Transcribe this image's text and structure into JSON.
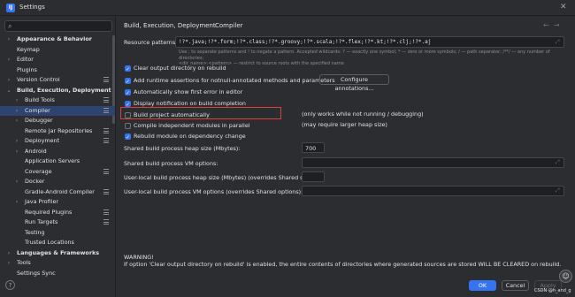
{
  "window": {
    "title": "Settings",
    "app_icon": "IJ"
  },
  "sidebar": {
    "items": [
      {
        "label": "Appearance & Behavior",
        "chev": "›",
        "indent": 0,
        "bold": true
      },
      {
        "label": "Keymap",
        "chev": "",
        "indent": 0
      },
      {
        "label": "Editor",
        "chev": "›",
        "indent": 0
      },
      {
        "label": "Plugins",
        "chev": "",
        "indent": 0
      },
      {
        "label": "Version Control",
        "chev": "›",
        "indent": 0,
        "sq": true
      },
      {
        "label": "Build, Execution, Deployment",
        "chev": "⌄",
        "indent": 0,
        "bold": true
      },
      {
        "label": "Build Tools",
        "chev": "›",
        "indent": 1,
        "sq": true
      },
      {
        "label": "Compiler",
        "chev": "›",
        "indent": 1,
        "sq": true,
        "selected": true
      },
      {
        "label": "Debugger",
        "chev": "›",
        "indent": 1
      },
      {
        "label": "Remote Jar Repositories",
        "chev": "",
        "indent": 1,
        "sq": true
      },
      {
        "label": "Deployment",
        "chev": "›",
        "indent": 1,
        "sq": true
      },
      {
        "label": "Android",
        "chev": "›",
        "indent": 1
      },
      {
        "label": "Application Servers",
        "chev": "",
        "indent": 1
      },
      {
        "label": "Coverage",
        "chev": "",
        "indent": 1,
        "sq": true
      },
      {
        "label": "Docker",
        "chev": "›",
        "indent": 1
      },
      {
        "label": "Gradle-Android Compiler",
        "chev": "",
        "indent": 1,
        "sq": true
      },
      {
        "label": "Java Profiler",
        "chev": "›",
        "indent": 1
      },
      {
        "label": "Required Plugins",
        "chev": "",
        "indent": 1,
        "sq": true
      },
      {
        "label": "Run Targets",
        "chev": "",
        "indent": 1,
        "sq": true
      },
      {
        "label": "Testing",
        "chev": "",
        "indent": 1
      },
      {
        "label": "Trusted Locations",
        "chev": "",
        "indent": 1
      },
      {
        "label": "Languages & Frameworks",
        "chev": "›",
        "indent": 0,
        "bold": true
      },
      {
        "label": "Tools",
        "chev": "›",
        "indent": 0
      },
      {
        "label": "Settings Sync",
        "chev": "",
        "indent": 0
      }
    ]
  },
  "breadcrumb": {
    "parent": "Build, Execution, Deployment",
    "separator": "›",
    "current": "Compiler"
  },
  "resource_patterns": {
    "label": "Resource patterns:",
    "value": "!?*.java;!?*.form;!?*.class;!?*.groovy;!?*.scala;!?*.flex;!?*.kt;!?*.clj;!?*.aj",
    "hint_line1": "Use ; to separate patterns and ! to negate a pattern. Accepted wildcards: ? — exactly one symbol; * — zero or more symbols; / — path separator; /**/ — any number of directories;",
    "hint_line2": "<dir_name>:<pattern> — restrict to source roots with the specified name"
  },
  "options": [
    {
      "label": "Clear output directory on rebuild",
      "checked": true
    },
    {
      "label": "Add runtime assertions for notnull-annotated methods and parameters",
      "checked": true
    },
    {
      "label": "Automatically show first error in editor",
      "checked": true
    },
    {
      "label": "Display notification on build completion",
      "checked": true
    },
    {
      "label": "Build project automatically",
      "checked": false
    },
    {
      "label": "Compile independent modules in parallel",
      "checked": false
    },
    {
      "label": "Rebuild module on dependency change",
      "checked": true
    }
  ],
  "configure_button": "Configure annotations...",
  "notes": {
    "build_auto": "(only works while not running / debugging)",
    "parallel": "(may require larger heap size)"
  },
  "fields": {
    "heap_label": "Shared build process heap size (Mbytes):",
    "heap_value": "700",
    "vm_label": "Shared build process VM options:",
    "user_heap_label": "User-local build process heap size (Mbytes) (overrides Shared size):",
    "user_vm_label": "User-local build process VM options (overrides Shared options):"
  },
  "warning": {
    "title": "WARNING!",
    "text": "If option 'Clear output directory on rebuild' is enabled, the entire contents of directories where generated sources are stored WILL BE CLEARED on rebuild."
  },
  "footer": {
    "help": "?",
    "ok": "OK",
    "cancel": "Cancel",
    "apply": "Apply"
  },
  "watermark": "CSDN @h_and_g",
  "accent_color": "#3574f0",
  "highlight_color": "#e03c3c"
}
